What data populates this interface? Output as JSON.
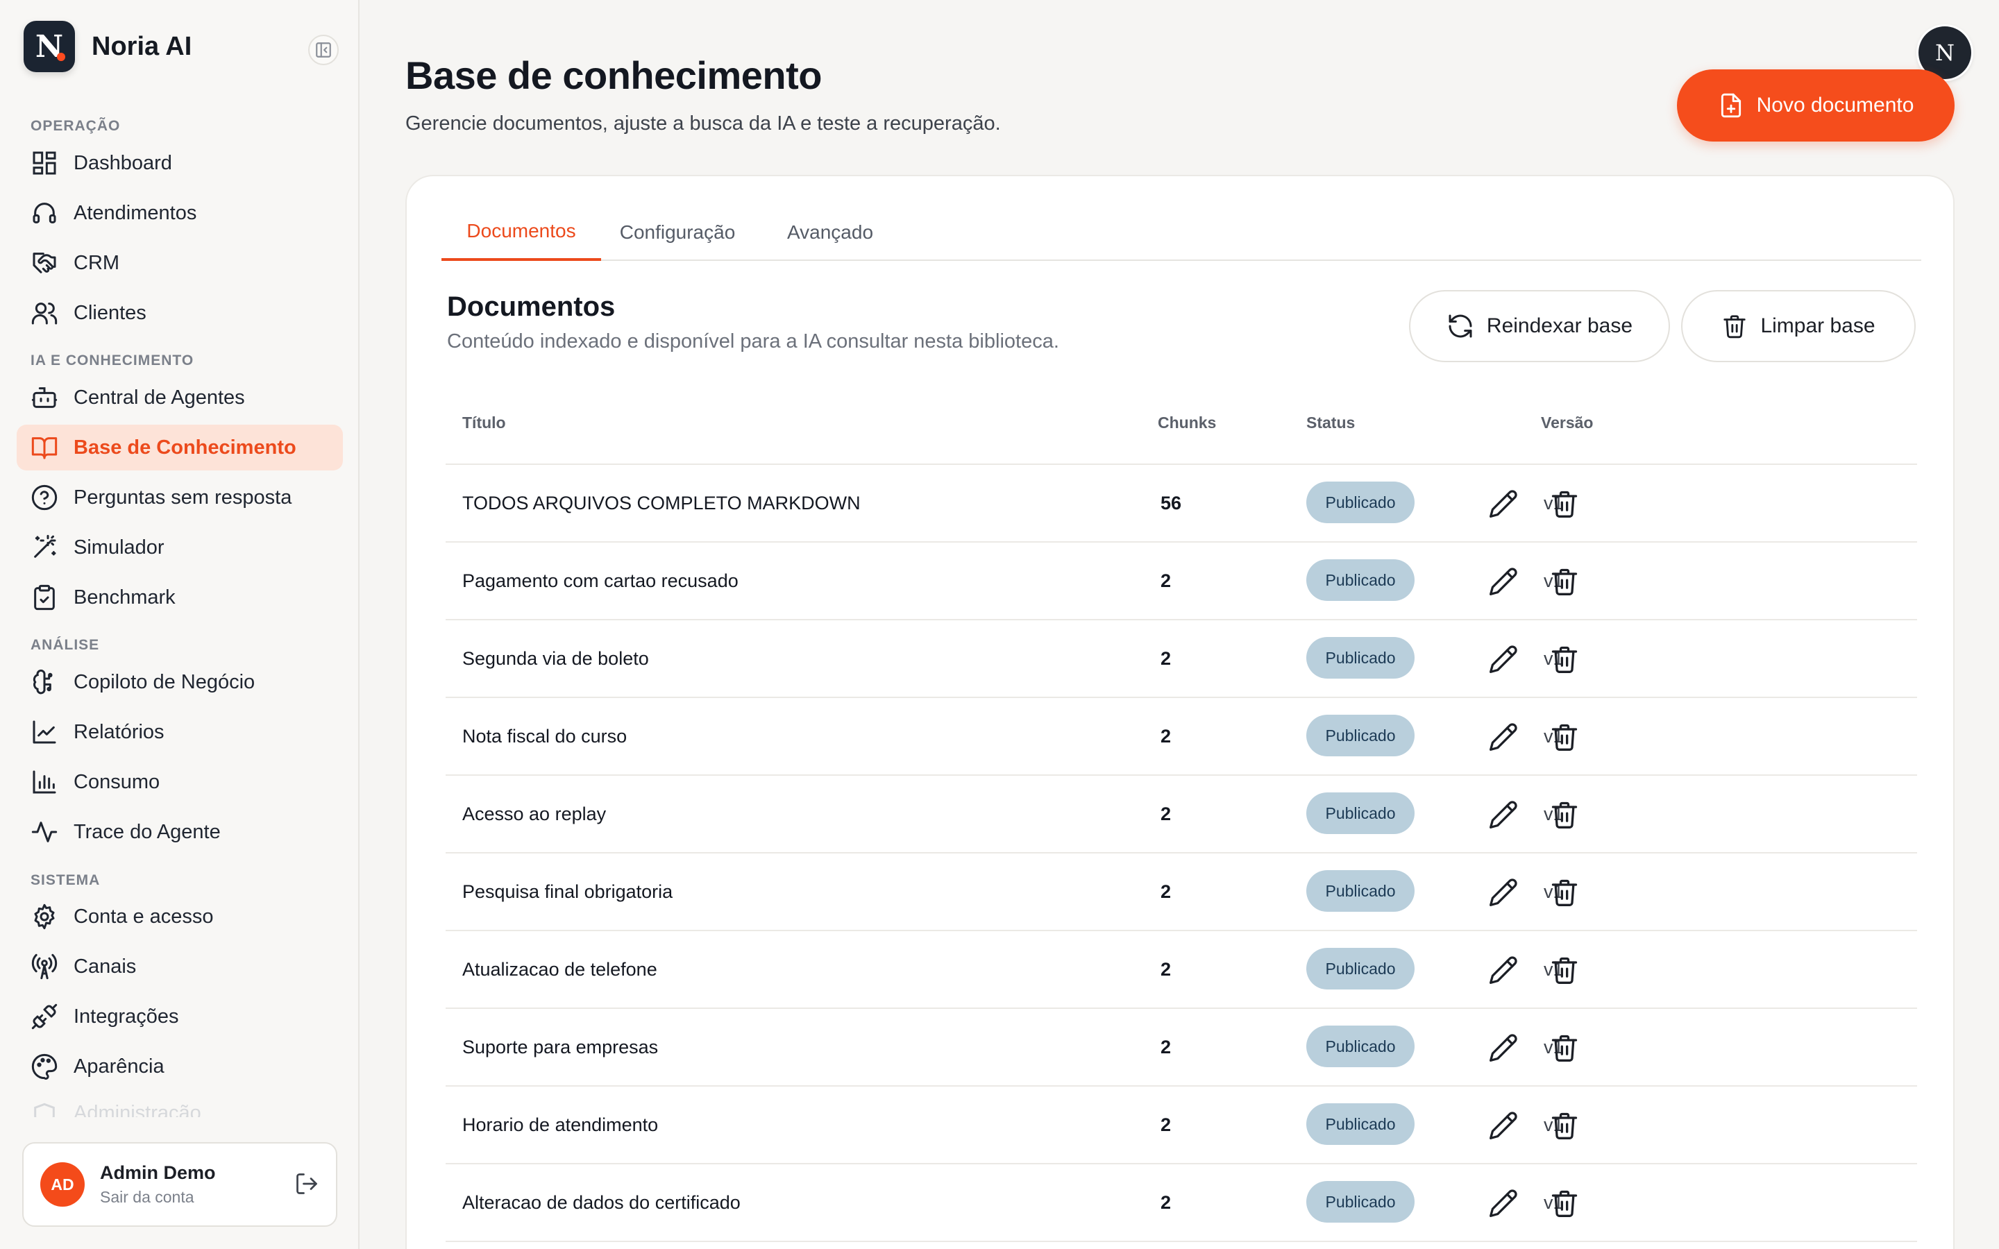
{
  "app": {
    "name": "Noria AI",
    "logo_letter": "N"
  },
  "sidebar": {
    "sections": [
      {
        "label": "OPERAÇÃO"
      },
      {
        "label": "IA E CONHECIMENTO"
      },
      {
        "label": "ANÁLISE"
      },
      {
        "label": "SISTEMA"
      }
    ],
    "items": [
      {
        "label": "Dashboard",
        "icon": "dashboard-icon"
      },
      {
        "label": "Atendimentos",
        "icon": "headset-icon"
      },
      {
        "label": "CRM",
        "icon": "handshake-icon"
      },
      {
        "label": "Clientes",
        "icon": "users-icon"
      },
      {
        "label": "Central de Agentes",
        "icon": "bot-icon"
      },
      {
        "label": "Base de Conhecimento",
        "icon": "book-icon",
        "active": true
      },
      {
        "label": "Perguntas sem resposta",
        "icon": "question-icon"
      },
      {
        "label": "Simulador",
        "icon": "magic-wand-icon"
      },
      {
        "label": "Benchmark",
        "icon": "clipboard-check-icon"
      },
      {
        "label": "Copiloto de Negócio",
        "icon": "brain-icon"
      },
      {
        "label": "Relatórios",
        "icon": "line-chart-icon"
      },
      {
        "label": "Consumo",
        "icon": "bar-chart-icon"
      },
      {
        "label": "Trace do Agente",
        "icon": "activity-icon"
      },
      {
        "label": "Conta e acesso",
        "icon": "gear-icon"
      },
      {
        "label": "Canais",
        "icon": "radio-tower-icon"
      },
      {
        "label": "Integrações",
        "icon": "plug-icon"
      },
      {
        "label": "Aparência",
        "icon": "palette-icon"
      },
      {
        "label": "Administração",
        "icon": "shield-icon"
      }
    ],
    "user": {
      "initials": "AD",
      "name": "Admin Demo",
      "action": "Sair da conta"
    }
  },
  "header": {
    "title": "Base de conhecimento",
    "subtitle": "Gerencie documentos, ajuste a busca da IA e teste a recuperação.",
    "new_button": "Novo documento",
    "avatar_letter": "N"
  },
  "tabs": [
    {
      "label": "Documentos",
      "active": true
    },
    {
      "label": "Configuração"
    },
    {
      "label": "Avançado"
    }
  ],
  "documents": {
    "title": "Documentos",
    "subtitle": "Conteúdo indexado e disponível para a IA consultar nesta biblioteca.",
    "reindex_button": "Reindexar base",
    "clear_button": "Limpar base",
    "columns": {
      "title": "Título",
      "chunks": "Chunks",
      "status": "Status",
      "version": "Versão"
    },
    "rows": [
      {
        "title": "TODOS ARQUIVOS COMPLETO MARKDOWN",
        "chunks": "56",
        "status": "Publicado",
        "version": "v1"
      },
      {
        "title": "Pagamento com cartao recusado",
        "chunks": "2",
        "status": "Publicado",
        "version": "v1"
      },
      {
        "title": "Segunda via de boleto",
        "chunks": "2",
        "status": "Publicado",
        "version": "v1"
      },
      {
        "title": "Nota fiscal do curso",
        "chunks": "2",
        "status": "Publicado",
        "version": "v1"
      },
      {
        "title": "Acesso ao replay",
        "chunks": "2",
        "status": "Publicado",
        "version": "v1"
      },
      {
        "title": "Pesquisa final obrigatoria",
        "chunks": "2",
        "status": "Publicado",
        "version": "v1"
      },
      {
        "title": "Atualizacao de telefone",
        "chunks": "2",
        "status": "Publicado",
        "version": "v1"
      },
      {
        "title": "Suporte para empresas",
        "chunks": "2",
        "status": "Publicado",
        "version": "v1"
      },
      {
        "title": "Horario de atendimento",
        "chunks": "2",
        "status": "Publicado",
        "version": "v1"
      },
      {
        "title": "Alteracao de dados do certificado",
        "chunks": "2",
        "status": "Publicado",
        "version": "v1"
      }
    ]
  },
  "colors": {
    "accent": "#f54d1c",
    "active_bg": "#fde3d8",
    "badge_bg": "#b9cfdc"
  }
}
